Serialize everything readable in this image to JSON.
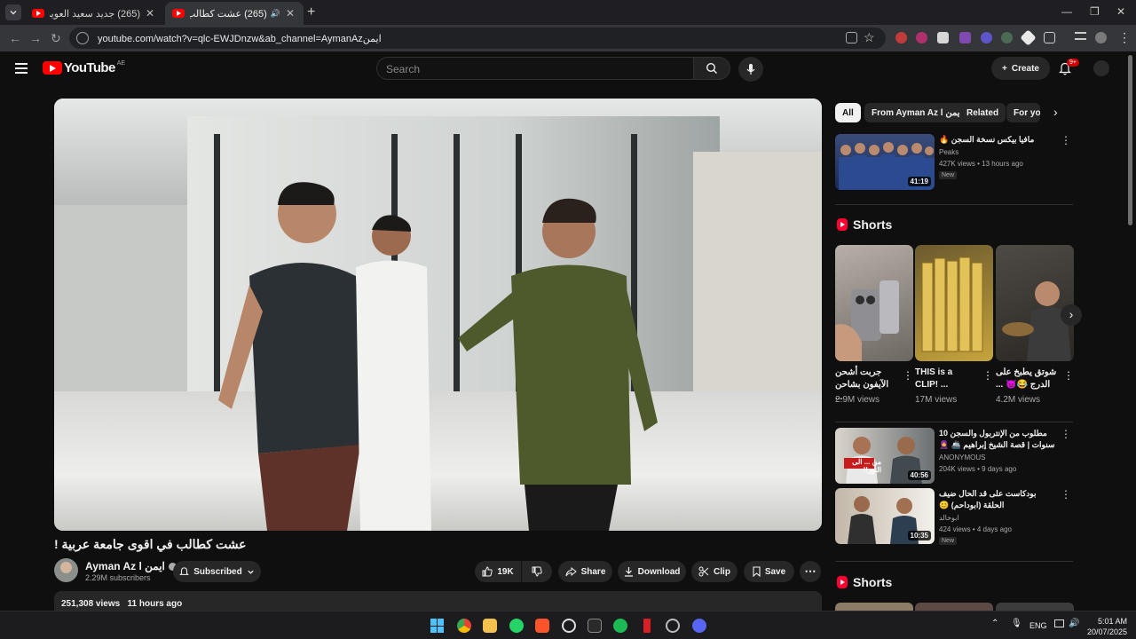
{
  "browser": {
    "tabs": [
      {
        "title": "(265) جديد سعيد العويران - اني",
        "active": false
      },
      {
        "title": "(265) عشت كطالب في اقوى",
        "active": true
      }
    ],
    "new_tab": "+",
    "url": "youtube.com/watch?v=qlc-EWJDnzw&ab_channel=AymanAzايمن",
    "window_controls": [
      "—",
      "❐",
      "✕"
    ]
  },
  "masthead": {
    "logo_text": "YouTube",
    "country_code": "AE",
    "search_placeholder": "Search",
    "create_label": "Create",
    "notification_count": "9+"
  },
  "video": {
    "title": "عشت كطالب في اقوى جامعة عربية !",
    "channel_name": "Ayman Az l ايمن",
    "subscribers": "2.29M subscribers",
    "subscribed_label": "Subscribed",
    "likes": "19K",
    "share_label": "Share",
    "download_label": "Download",
    "clip_label": "Clip",
    "save_label": "Save",
    "views": "251,308 views",
    "posted": "11 hours ago"
  },
  "chips": [
    "All",
    "From Ayman Az l ايمن",
    "Related",
    "For you"
  ],
  "recommendations": [
    {
      "title": "مافيا بيكس نسخة السجن 🔥",
      "channel": "Peaks",
      "meta": "427K views • 13 hours ago",
      "badge": "New",
      "duration": "41:19"
    },
    {
      "title": "مطلوب من الإنتربول والسجن 10 سنوات | قصة الشيخ إبراهيم 🚢 🧕",
      "channel": "ANONYMOUS",
      "meta": "204K views • 9 days ago",
      "badge": "",
      "duration": "40:56"
    },
    {
      "title": "بودكاست على قد الحال ضيف الحلقة (ابوداحم) 😊",
      "channel": "ابوخالد",
      "meta": "424 views • 4 days ago",
      "badge": "New",
      "duration": "10:35"
    }
  ],
  "shorts_heading": "Shorts",
  "shorts": [
    {
      "title": "جربت أشحن الآيفون بشاحن ...",
      "views": "2.9M views"
    },
    {
      "title": "THIS is a CLIP! ...",
      "views": "17M views"
    },
    {
      "title": "شوتق يطبخ على الدرج 😂😈 ...",
      "views": "4.2M views"
    }
  ],
  "thumb_overlay_text": "من ... الى النور!!",
  "taskbar": {
    "language": "ENG",
    "time": "5:01 AM",
    "date": "20/07/2025"
  },
  "colors": {
    "accent": "#ff0000",
    "background": "#0f0f0f",
    "surface": "#272727"
  }
}
